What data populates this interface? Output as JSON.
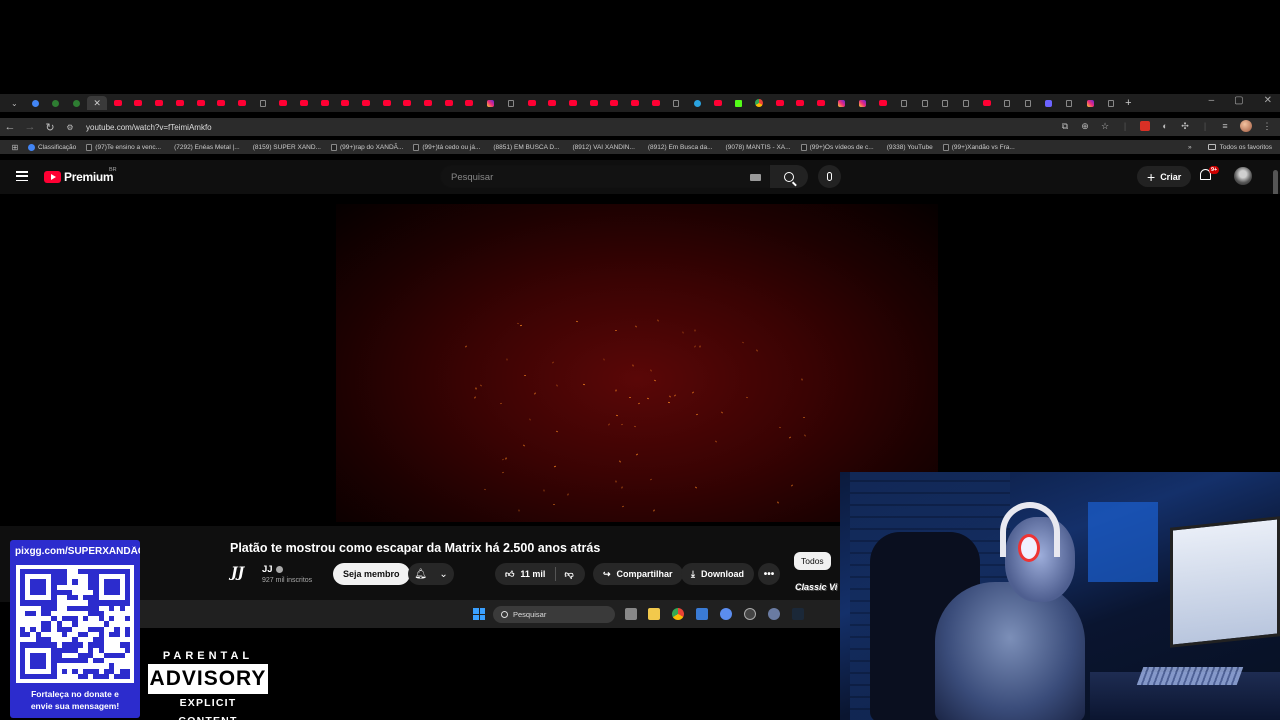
{
  "browser": {
    "tabs": [
      "yt",
      "yt",
      "yt",
      "yt",
      "yt",
      "yt",
      "yt",
      "tt",
      "yt",
      "yt",
      "yt",
      "yt",
      "yt",
      "yt",
      "yt",
      "yt",
      "yt",
      "yt",
      "ig",
      "tt",
      "yt",
      "yt",
      "yt",
      "yt",
      "yt",
      "yt",
      "yt",
      "tt",
      "tg",
      "yt",
      "kk",
      "gc",
      "yt",
      "yt",
      "yt",
      "ig",
      "ig",
      "yt",
      "tt",
      "tt",
      "tt",
      "tt",
      "yt",
      "tt",
      "tt",
      "ms",
      "tt",
      "ig",
      "tt"
    ],
    "url": "youtube.com/watch?v=fTeimiAmkfo",
    "bookmarks": [
      {
        "label": "Classificação",
        "icon": "ai"
      },
      {
        "label": "(97)Te ensino a venc...",
        "icon": "tt"
      },
      {
        "label": "(7292) Enéas Metal |...",
        "icon": "yt"
      },
      {
        "label": "(8159) SUPER XAND...",
        "icon": "yt"
      },
      {
        "label": "(99+)rap do XANDÃ...",
        "icon": "tt"
      },
      {
        "label": "(99+)tá cedo ou já...",
        "icon": "tt"
      },
      {
        "label": "(8851) EM BUSCA D...",
        "icon": "yt"
      },
      {
        "label": "(8912) VAI XANDIN...",
        "icon": "yt"
      },
      {
        "label": "(8912) Em Busca da...",
        "icon": "yt"
      },
      {
        "label": "(9078) MANTIS - XA...",
        "icon": "yt"
      },
      {
        "label": "(99+)Os vídeos de c...",
        "icon": "tt"
      },
      {
        "label": "(9338) YouTube",
        "icon": "yt"
      },
      {
        "label": "(99+)Xandão vs Fra...",
        "icon": "tt"
      }
    ],
    "all_bookmarks": "Todos os favoritos"
  },
  "youtube": {
    "brand": "Premium",
    "country": "BR",
    "search_placeholder": "Pesquisar",
    "create_label": "Criar",
    "notification_badge": "9+",
    "video": {
      "title": "Platão te mostrou como escapar da Matrix há 2.500 anos atrás",
      "channel_logo": "JJ",
      "channel": "JJ",
      "subscribers": "927 mil inscritos",
      "join_label": "Seja membro",
      "likes": "11 mil",
      "share_label": "Compartilhar",
      "download_label": "Download",
      "more_label": "•••"
    },
    "filter_chip": "Todos",
    "sidebar_partial": "Classic Vi"
  },
  "taskbar": {
    "search_placeholder": "Pesquisar"
  },
  "overlay": {
    "pix_url": "pixgg.com/SUPERXANDÃO",
    "pix_message_line1": "Fortaleça no donate e",
    "pix_message_line2": "envie sua mensagem!",
    "advisory_line1": "PARENTAL",
    "advisory_line2": "ADVISORY",
    "advisory_line3": "EXPLICIT CONTENT"
  },
  "colors": {
    "youtube_red": "#ff0033",
    "qr_panel": "#2c2ccd",
    "background": "#0f0f0f"
  }
}
